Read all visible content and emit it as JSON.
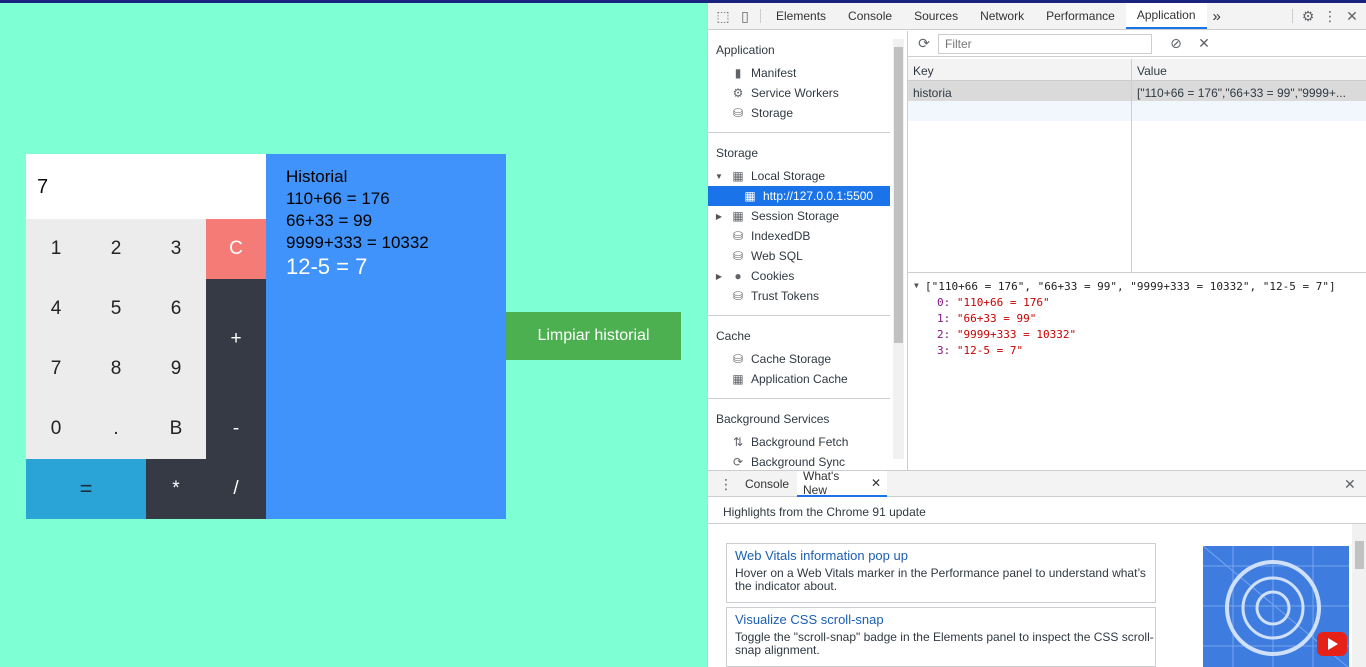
{
  "calculator": {
    "display": "7",
    "keys": [
      "1",
      "2",
      "3",
      "C",
      "4",
      "5",
      "6",
      "+",
      "7",
      "8",
      "9",
      "-",
      "0",
      ".",
      "B",
      "=",
      "*",
      "/"
    ]
  },
  "history": {
    "title": "Historial",
    "items": [
      "110+66 = 176",
      "66+33 = 99",
      "9999+333 = 10332"
    ],
    "last": "12-5 = 7"
  },
  "clear_button": "Limpiar historial",
  "devtools": {
    "tabs": [
      "Elements",
      "Console",
      "Sources",
      "Network",
      "Performance",
      "Application"
    ],
    "more": "»",
    "sidebar": {
      "application_header": "Application",
      "application_items": [
        "Manifest",
        "Service Workers",
        "Storage"
      ],
      "storage_header": "Storage",
      "storage_items": [
        "Local Storage",
        "http://127.0.0.1:5500",
        "Session Storage",
        "IndexedDB",
        "Web SQL",
        "Cookies",
        "Trust Tokens"
      ],
      "cache_header": "Cache",
      "cache_items": [
        "Cache Storage",
        "Application Cache"
      ],
      "background_header": "Background Services",
      "background_items": [
        "Background Fetch",
        "Background Sync"
      ]
    },
    "filter_placeholder": "Filter",
    "table": {
      "key_header": "Key",
      "value_header": "Value",
      "row_key": "historia",
      "row_value": "[\"110+66 = 176\",\"66+33 = 99\",\"9999+..."
    },
    "preview": {
      "summary": "[\"110+66 = 176\", \"66+33 = 99\", \"9999+333 = 10332\", \"12-5 = 7\"]",
      "entries": [
        {
          "index": "0:",
          "value": "\"110+66 = 176\""
        },
        {
          "index": "1:",
          "value": "\"66+33 = 99\""
        },
        {
          "index": "2:",
          "value": "\"9999+333 = 10332\""
        },
        {
          "index": "3:",
          "value": "\"12-5 = 7\""
        }
      ]
    },
    "drawer": {
      "tabs": [
        "Console",
        "What's New"
      ],
      "highlights": "Highlights from the Chrome 91 update",
      "cards": [
        {
          "title": "Web Vitals information pop up",
          "desc": "Hover on a Web Vitals marker in the Performance panel to understand what’s the indicator about."
        },
        {
          "title": "Visualize CSS scroll-snap",
          "desc": "Toggle the \"scroll-snap\" badge in the Elements panel to inspect the CSS scroll-snap alignment."
        }
      ]
    }
  }
}
